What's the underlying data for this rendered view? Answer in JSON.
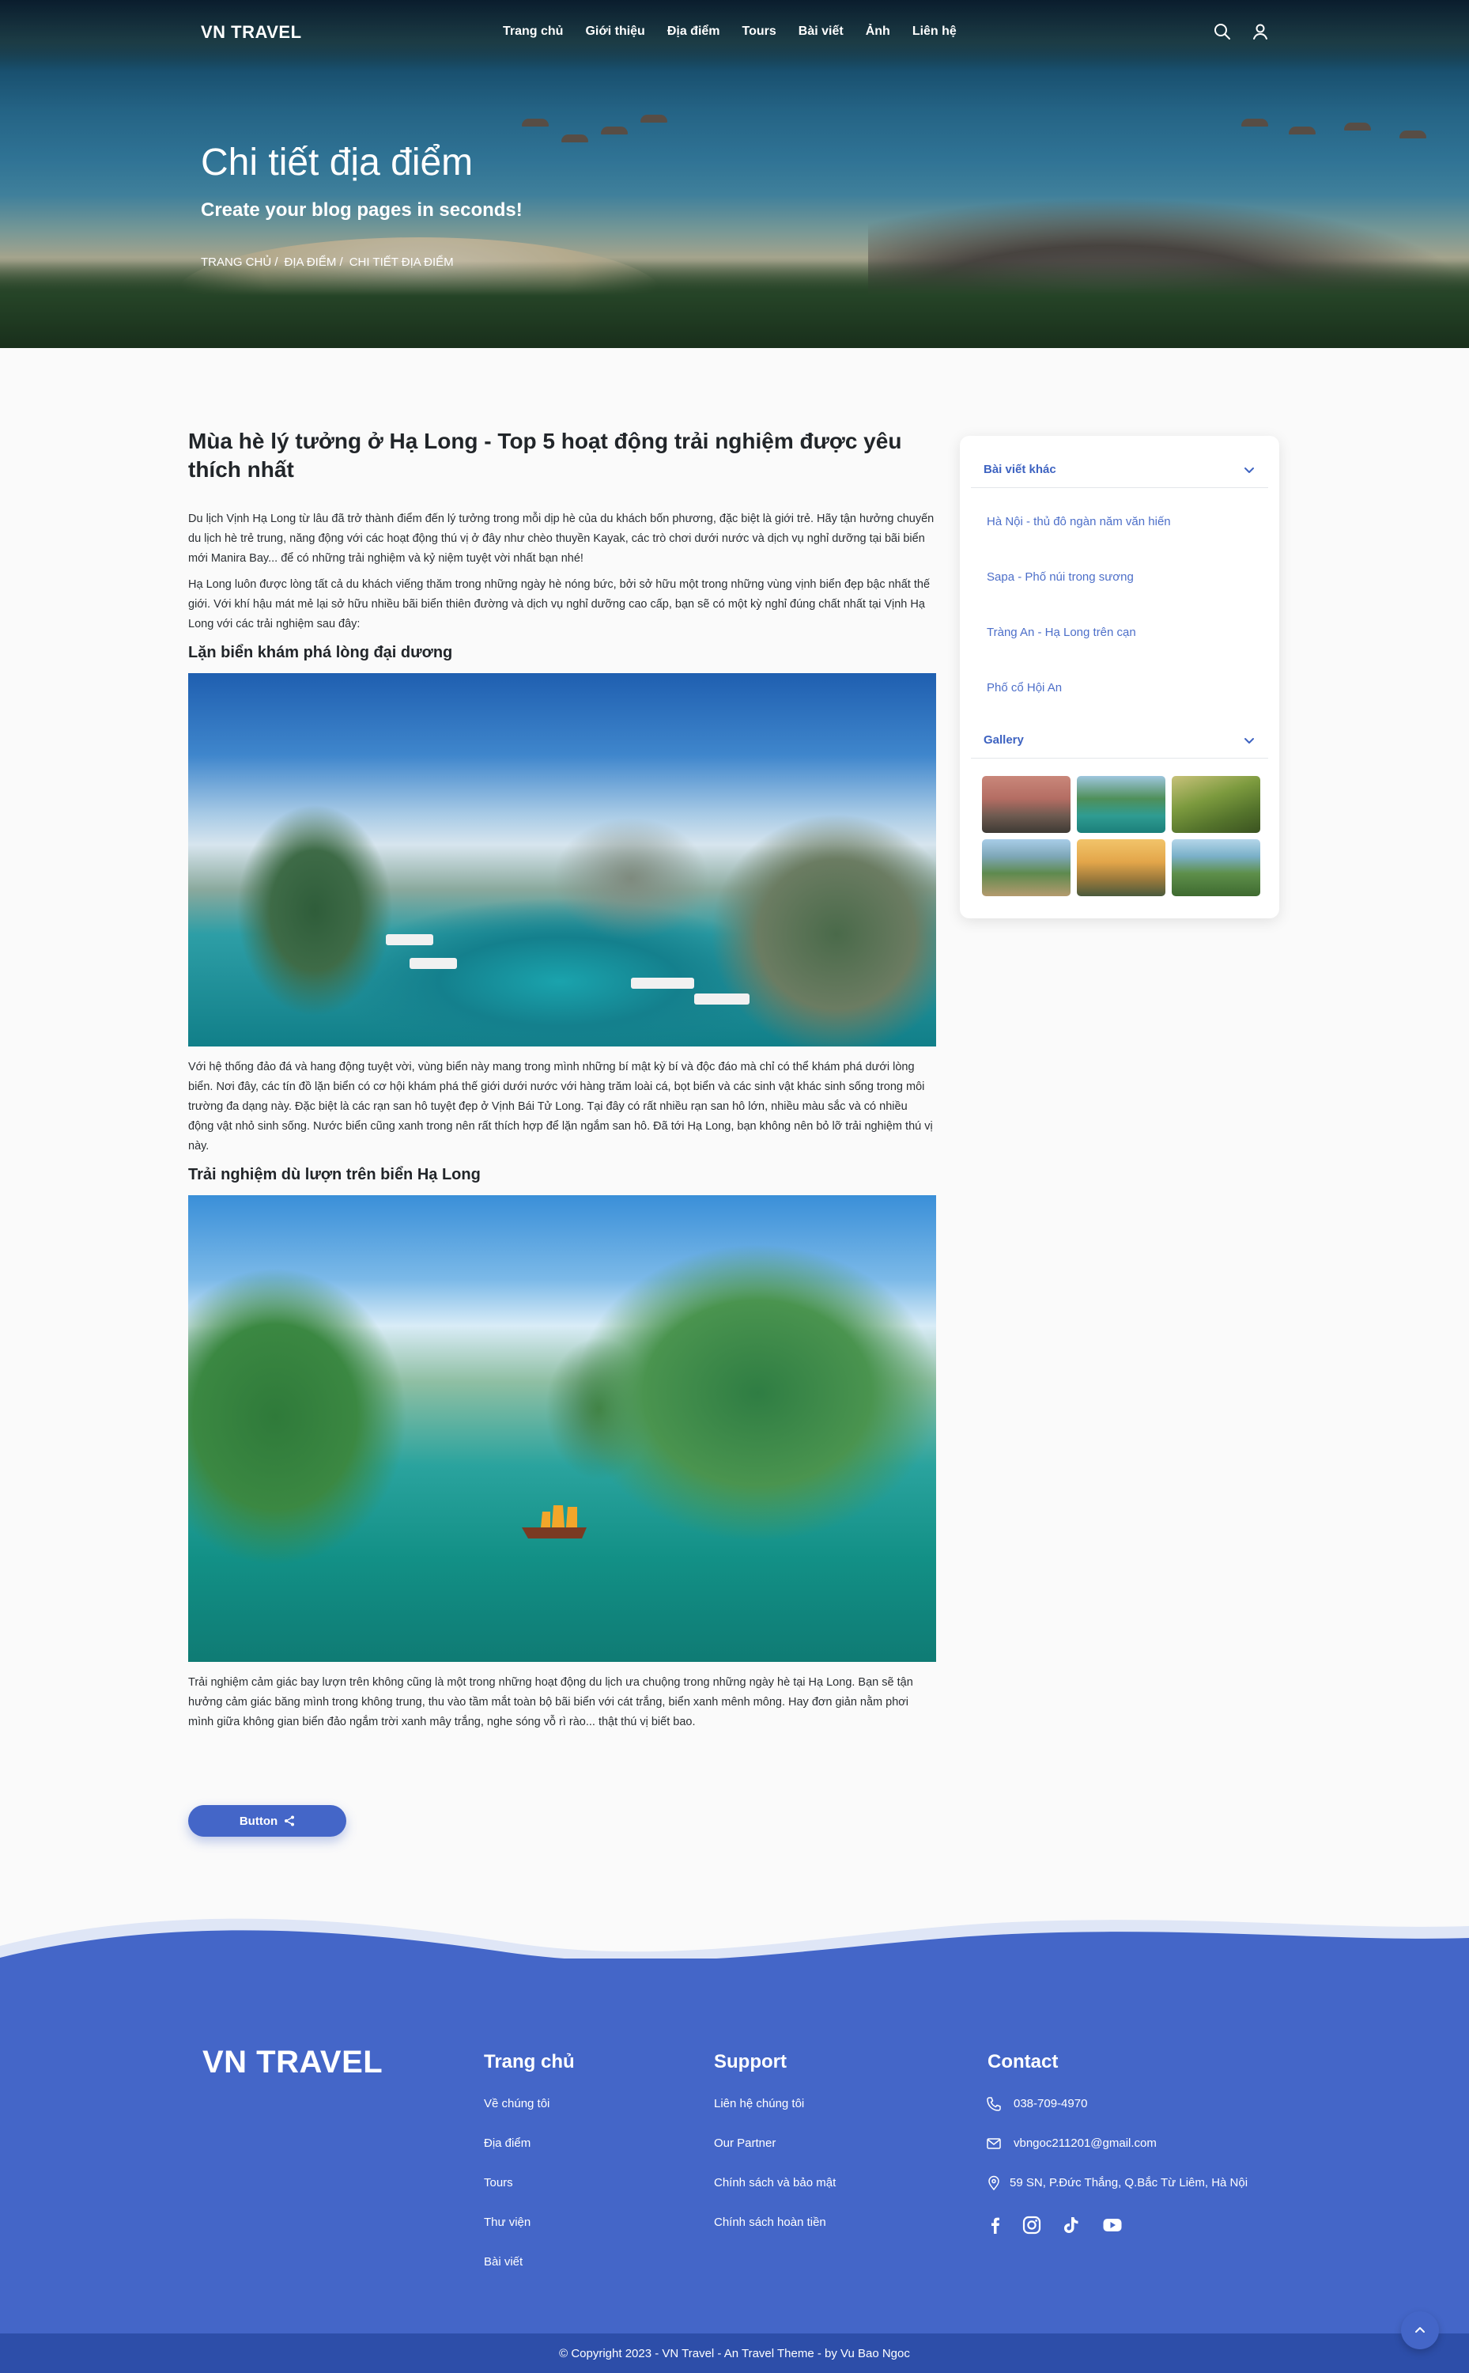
{
  "header": {
    "brand": "VN TRAVEL",
    "menu": [
      "Trang chủ",
      "Giới thiệu",
      "Địa điểm",
      "Tours",
      "Bài viết",
      "Ảnh",
      "Liên hệ"
    ],
    "icons": [
      "search-icon",
      "user-icon"
    ]
  },
  "hero": {
    "title": "Chi tiết địa điểm",
    "subtitle": "Create your blog pages in seconds!",
    "breadcrumb": [
      "TRANG CHỦ /",
      "ĐỊA ĐIỂM /",
      "CHI TIẾT ĐỊA ĐIỂM"
    ]
  },
  "article": {
    "title": "Mùa hè lý tưởng ở Hạ Long - Top 5 hoạt động trải nghiệm được yêu thích nhất",
    "p1": "Du lịch Vịnh Hạ Long từ lâu đã trở thành điểm đến lý tưởng trong mỗi dịp hè của du khách bốn phương, đặc biệt là giới trẻ. Hãy tận hưởng chuyến du lịch hè trẻ trung, năng động với các hoạt động thú vị ở đây như chèo thuyền Kayak, các trò chơi dưới nước và dịch vụ nghỉ dưỡng tại bãi biển mới Manira Bay... để có những trải nghiệm và kỷ niệm tuyệt vời nhất bạn nhé!",
    "p2": "Hạ Long luôn được lòng tất cả du khách viếng thăm trong những ngày hè nóng bức, bởi sở hữu một trong những vùng vịnh biển đẹp bậc nhất thế giới. Với khí hậu mát mẻ lại sở hữu nhiều bãi biển thiên đường và dịch vụ nghỉ dưỡng cao cấp, bạn sẽ có một kỳ nghỉ đúng chất nhất tại Vịnh Hạ Long với các trải nghiệm sau đây:",
    "h1": "Lặn biển khám phá lòng đại dương",
    "p3": "Với hệ thống đảo đá và hang động tuyệt vời, vùng biển này mang trong mình những bí mật kỳ bí và độc đáo mà chỉ có thể khám phá dưới lòng biển. Nơi đây, các tín đồ lặn biển có cơ hội khám phá thế giới dưới nước với hàng trăm loài cá, bọt biển và các sinh vật khác sinh sống trong môi trường đa dạng này. Đặc biệt là các rạn san hô tuyệt đẹp ở Vịnh Bái Tử Long. Tại đây có rất nhiều rạn san hô lớn, nhiều màu sắc và có nhiều động vật nhỏ sinh sống. Nước biển cũng xanh trong nên rất thích hợp để lặn ngắm san hô. Đã tới Hạ Long, bạn không nên bỏ lỡ trải nghiệm thú vị này.",
    "h2": "Trải nghiệm dù lượn trên biển Hạ Long",
    "p4": "Trải nghiệm cảm giác bay lượn trên không cũng là một trong những hoạt động du lịch ưa chuộng trong những ngày hè tại Hạ Long. Bạn sẽ tận hưởng cảm giác băng mình trong không trung, thu vào tầm mắt toàn bộ bãi biển với cát trắng, biển xanh mênh mông. Hay đơn giản nằm phơi mình giữa không gian biển đảo ngắm trời xanh mây trắng, nghe sóng vỗ rì rào... thật thú vị biết bao.",
    "button": "Button"
  },
  "sidebar": {
    "posts_title": "Bài viết khác",
    "posts": [
      "Hà Nội - thủ đô ngàn năm văn hiến",
      "Sapa - Phố núi trong sương",
      "Tràng An - Hạ Long trên cạn",
      "Phố cổ Hội An"
    ],
    "gallery_title": "Gallery"
  },
  "footer": {
    "brand": "VN TRAVEL",
    "col1_title": "Trang chủ",
    "col1": [
      "Về chúng tôi",
      "Địa điểm",
      "Tours",
      "Thư viện",
      "Bài viết"
    ],
    "col2_title": "Support",
    "col2": [
      "Liên hệ chúng tôi",
      "Our Partner",
      "Chính sách và bảo mật",
      "Chính sách hoàn tiền"
    ],
    "col3_title": "Contact",
    "phone": "038-709-4970",
    "email": "vbngoc211201@gmail.com",
    "address": "59 SN, P.Đức Thắng, Q.Bắc Từ Liêm, Hà Nội",
    "socials": [
      "facebook-icon",
      "instagram-icon",
      "tiktok-icon",
      "youtube-icon"
    ],
    "copyright": "© Copyright 2023 - VN Travel - An Travel Theme - by Vu Bao Ngoc"
  },
  "colors": {
    "primary": "#4466c8",
    "copybar": "#2d4ea9",
    "link": "#4d6fc9"
  }
}
